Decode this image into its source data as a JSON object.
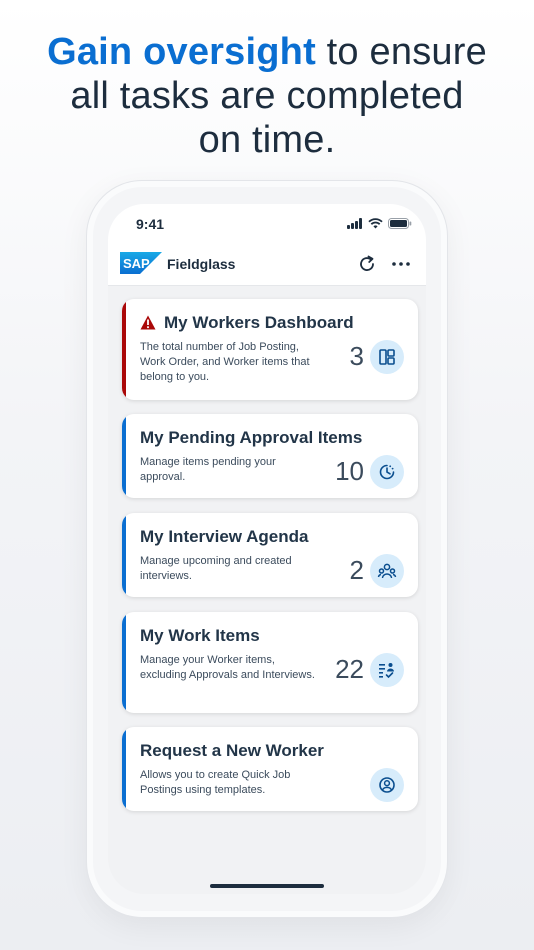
{
  "headline": {
    "highlight": "Gain oversight",
    "line1_rest": " to ensure",
    "line2": "all tasks are completed",
    "line3": "on time."
  },
  "status_bar": {
    "time": "9:41"
  },
  "app": {
    "logo_text": "SAP",
    "title": "Fieldglass"
  },
  "cards": [
    {
      "title": "My Workers Dashboard",
      "description": "The total number of Job Posting, Work Order, and Worker items that belong to you.",
      "count": "3",
      "icon": "dashboard-icon",
      "status": "alert"
    },
    {
      "title": "My Pending Approval Items",
      "description": "Manage items pending your approval.",
      "count": "10",
      "icon": "pending-clock-icon",
      "status": "info"
    },
    {
      "title": "My Interview Agenda",
      "description": "Manage upcoming and created interviews.",
      "count": "2",
      "icon": "interview-group-icon",
      "status": "info"
    },
    {
      "title": "My Work Items",
      "description": "Manage your Worker items, excluding Approvals and Interviews.",
      "count": "22",
      "icon": "work-items-icon",
      "status": "info"
    },
    {
      "title": "Request a New Worker",
      "description": "Allows you to create Quick Job Postings using templates.",
      "count": "",
      "icon": "person-icon",
      "status": "info"
    }
  ],
  "colors": {
    "brand": "#0a6ed1",
    "alert": "#aa0808",
    "icon_bg": "#d7ecfb"
  }
}
